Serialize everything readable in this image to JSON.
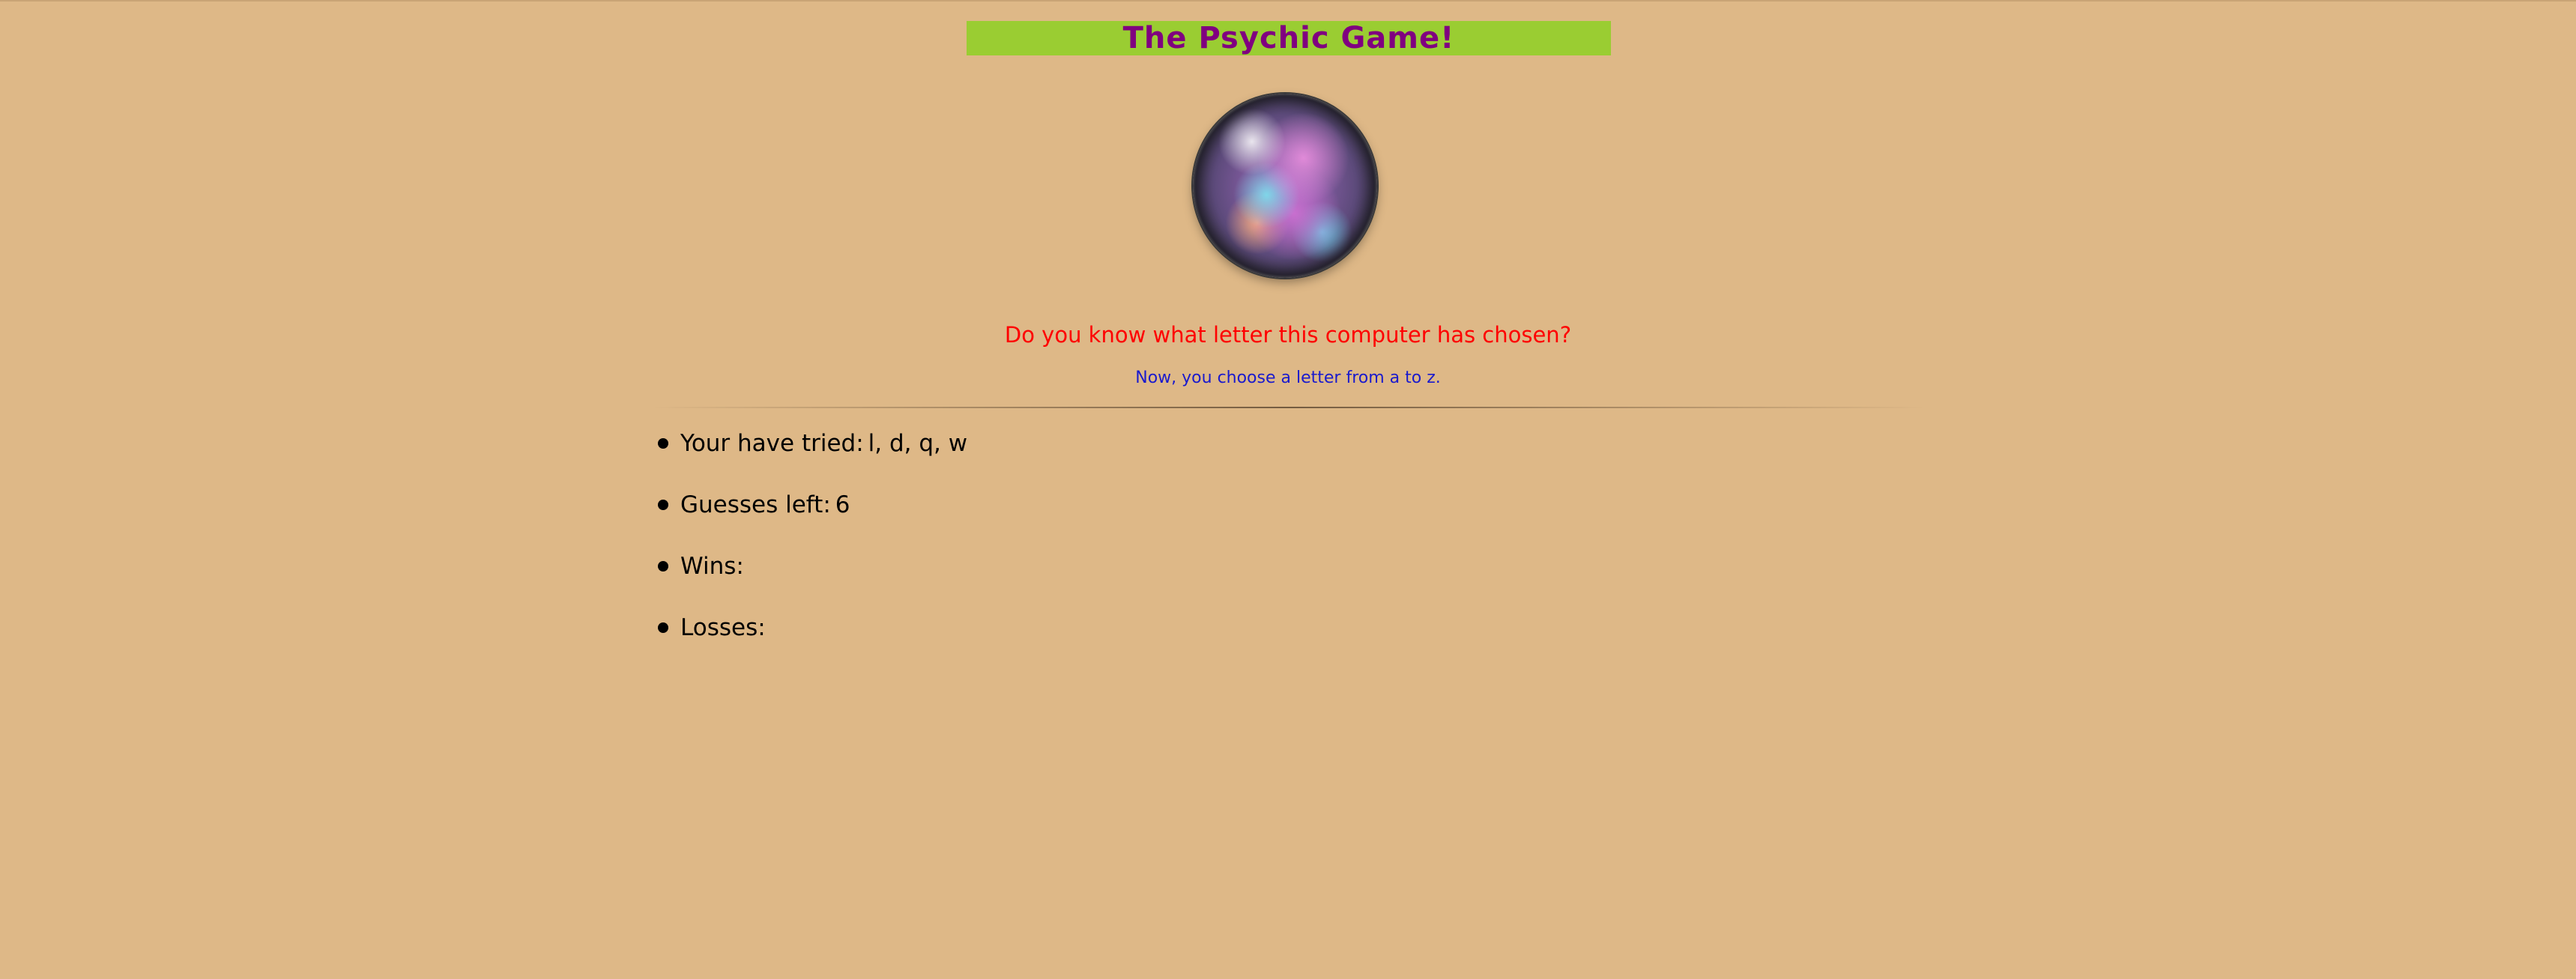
{
  "page": {
    "title": "The Psychic Game!",
    "question": "Do you know what letter this computer has chosen",
    "question_mark": "?",
    "instruction": "Now, you choose a letter from a to z."
  },
  "stats": {
    "tried_label": "Your have tried:",
    "tried_value": "l, d, q, w",
    "guesses_left_label": "Guesses left:",
    "guesses_left_value": "6",
    "wins_label": "Wins:",
    "wins_value": "",
    "losses_label": "Losses:",
    "losses_value": ""
  },
  "colors": {
    "background": "#deb887",
    "title_bar": "#9acd32",
    "title_text": "#800080",
    "question_text": "#ff0000",
    "instruction_text": "#1a1acd"
  },
  "icons": {
    "hero_image": "crystal-ball"
  }
}
